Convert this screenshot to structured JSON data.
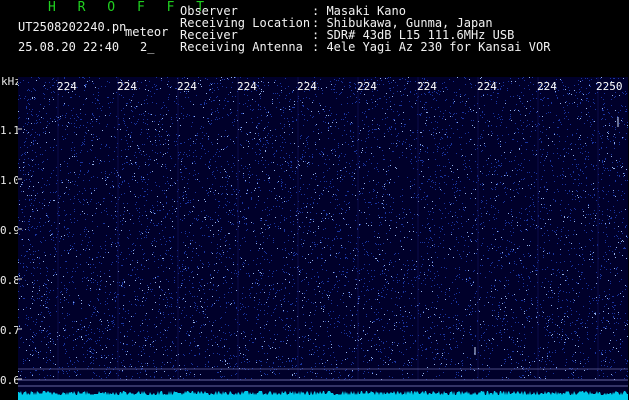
{
  "header": {
    "title": "H R O F F T",
    "filename": "UT2508202240.pn",
    "meteor_label": "meteor",
    "datetime": "25.08.20 22:40",
    "count": "2_",
    "fields": [
      {
        "label": "Observer",
        "value": ": Masaki Kano"
      },
      {
        "label": "Receiving Location",
        "value": ": Shibukawa, Gunma, Japan"
      },
      {
        "label": "Receiver",
        "value": ": SDR# 43dB L15 111.6MHz USB"
      },
      {
        "label": "Receiving Antenna",
        "value": ": 4ele Yagi Az 230 for Kansai VOR"
      }
    ]
  },
  "axis": {
    "y_unit": "kHz",
    "y_ticks": [
      "1.1",
      "1.0",
      "0.9",
      "0.8",
      "0.7",
      "0.6"
    ],
    "x_ticks": [
      "224",
      "224",
      "224",
      "224",
      "224",
      "224",
      "224",
      "224",
      "224",
      "2250"
    ]
  },
  "colors": {
    "background": "#00002a",
    "noise": "#3060ff",
    "noise_bright": "#b0d0ff",
    "signal_trace": "#00e0ff",
    "title": "#20d020"
  }
}
